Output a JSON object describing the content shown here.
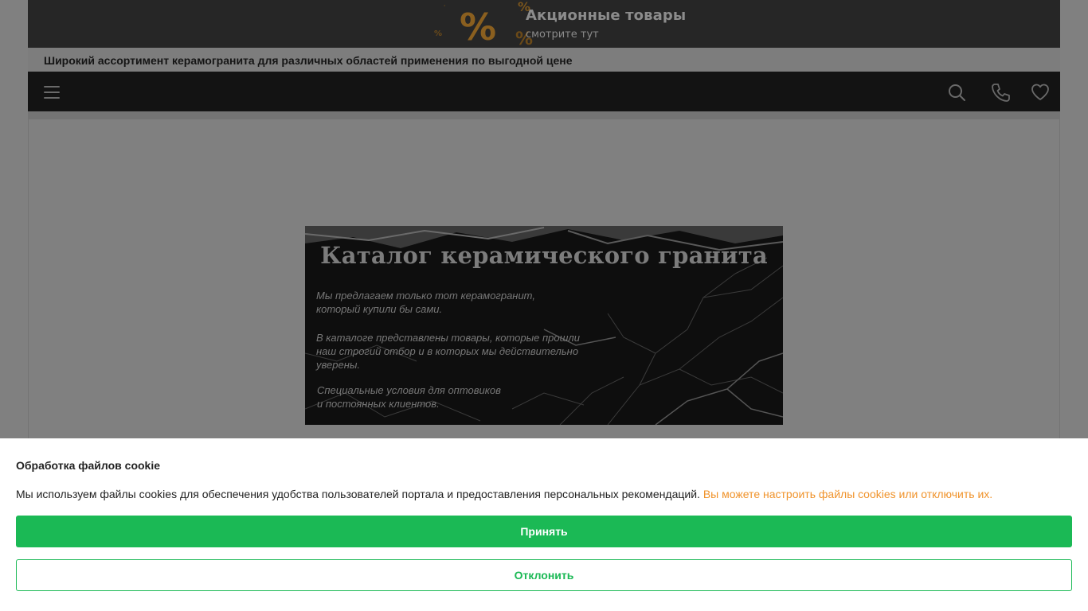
{
  "promo": {
    "title": "Акционные товары",
    "subtitle": "смотрите тут",
    "icon": "percent-icon"
  },
  "tagline": "Широкий ассортимент керамогранита для различных областей применения по выгодной цене",
  "nav": {
    "menu_icon": "hamburger-icon",
    "search_icon": "search-icon",
    "phone_icon": "phone-icon",
    "favorites_icon": "heart-icon"
  },
  "banner": {
    "title": "Каталог керамического гранита",
    "para1_line1": "Мы предлагаем только тот керамогранит,",
    "para1_line2": "который купили бы сами.",
    "para2_line1": "В каталоге представлены товары, которые прошли",
    "para2_line2": "наш строгий отбор и в которых мы действительно",
    "para2_line3": "уверены.",
    "para3_line1": "Специальные условия для оптовиков",
    "para3_line2": "и постоянных клиентов."
  },
  "cookie": {
    "title": "Обработка файлов cookie",
    "text": "Мы используем файлы cookies для обеспечения удобства пользователей портала и предоставления персональных рекомендаций.",
    "link": "Вы можете настроить файлы cookies или отключить их.",
    "accept_label": "Принять",
    "decline_label": "Отклонить"
  },
  "colors": {
    "accent_green": "#1bb955",
    "link_orange": "#f0932b",
    "overlay": "#808080",
    "nav_bg": "#131313"
  }
}
